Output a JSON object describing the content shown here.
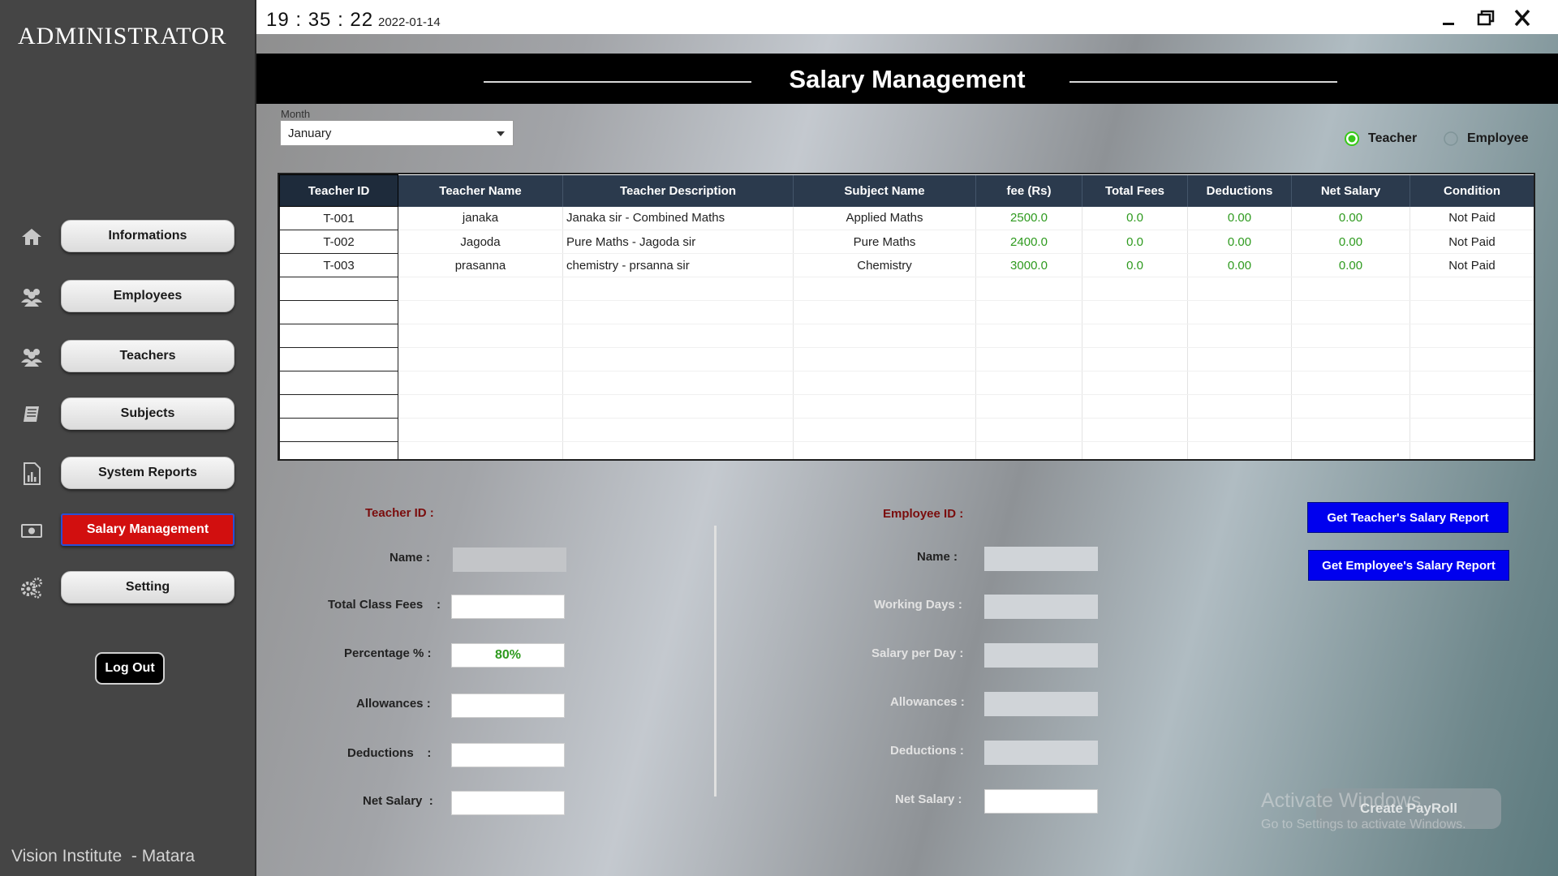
{
  "sidebar": {
    "title": "ADMINISTRATOR",
    "items": [
      {
        "label": "Informations",
        "icon": "home-icon"
      },
      {
        "label": "Employees",
        "icon": "group-icon"
      },
      {
        "label": "Teachers",
        "icon": "group-icon"
      },
      {
        "label": "Subjects",
        "icon": "book-icon"
      },
      {
        "label": "System Reports",
        "icon": "report-icon"
      },
      {
        "label": "Salary Management",
        "icon": "money-icon",
        "active": true
      },
      {
        "label": "Setting",
        "icon": "gears-icon"
      }
    ],
    "logout_label": "Log Out",
    "footer": "Vision Institute  - Matara"
  },
  "titlebar": {
    "clock": "19 : 35 : 22",
    "date": "2022-01-14"
  },
  "header": {
    "title": "Salary Management"
  },
  "month": {
    "label": "Month",
    "value": "January"
  },
  "radios": {
    "teacher": "Teacher",
    "employee": "Employee",
    "selected": "teacher"
  },
  "table": {
    "columns": [
      "Teacher ID",
      "Teacher Name",
      "Teacher Description",
      "Subject Name",
      "fee (Rs)",
      "Total Fees",
      "Deductions",
      "Net Salary",
      "Condition"
    ],
    "rows": [
      [
        "T-001",
        "janaka",
        "Janaka sir - Combined Maths",
        "Applied Maths",
        "2500.0",
        "0.0",
        "0.00",
        "0.00",
        "Not Paid"
      ],
      [
        "T-002",
        "Jagoda",
        "Pure Maths - Jagoda sir",
        "Pure Maths",
        "2400.0",
        "0.0",
        "0.00",
        "0.00",
        "Not Paid"
      ],
      [
        "T-003",
        "prasanna",
        "chemistry - prsanna sir",
        "Chemistry",
        "3000.0",
        "0.0",
        "0.00",
        "0.00",
        "Not Paid"
      ]
    ]
  },
  "teacher_form": {
    "teacher_id": "Teacher ID :",
    "name": "Name :",
    "total_class_fees": "Total Class Fees    :",
    "percentage": "Percentage % :",
    "percentage_value": "80%",
    "allowances": "Allowances :",
    "deductions": "Deductions    :",
    "net_salary": "Net Salary  :"
  },
  "employee_form": {
    "employee_id": "Employee ID :",
    "name": "Name :",
    "working_days": "Working Days :",
    "salary_per_day": "Salary per Day :",
    "allowances": "Allowances :",
    "deductions": "Deductions :",
    "net_salary": "Net Salary :"
  },
  "actions": {
    "teacher_report": "Get Teacher's Salary Report",
    "employee_report": "Get Employee's Salary Report",
    "create_payroll": "Create PayRoll"
  },
  "watermark": {
    "line1": "Activate Windows",
    "line2": "Go to Settings to activate Windows."
  },
  "colors": {
    "active_nav": "#d20f0f",
    "report_button": "#0000ee",
    "fee_text": "#2e9a1e",
    "radio_selected": "#39c81b"
  }
}
